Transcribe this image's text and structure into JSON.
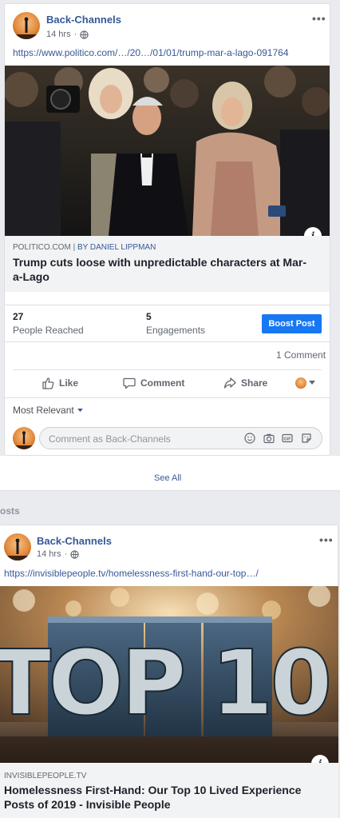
{
  "post1": {
    "page_name": "Back-Channels",
    "time": "14 hrs",
    "privacy_icon": "globe-icon",
    "url": "https://www.politico.com/…/20…/01/01/trump-mar-a-lago-091764",
    "source": "POLITICO.COM",
    "separator": " | ",
    "byline": "BY DANIEL LIPPMAN",
    "headline": "Trump cuts loose with unpredictable characters at Mar-a-Lago",
    "people_reached": "27",
    "people_reached_label": "People Reached",
    "engagements": "5",
    "engagements_label": "Engagements",
    "boost_label": "Boost Post",
    "comments_count": "1 Comment",
    "like_label": "Like",
    "comment_label": "Comment",
    "share_label": "Share",
    "most_relevant": "Most Relevant",
    "comment_placeholder": "Comment as Back-Channels"
  },
  "see_all": "See All",
  "section_title": "osts",
  "post2": {
    "page_name": "Back-Channels",
    "time": "14 hrs",
    "privacy_icon": "globe-icon",
    "url": "https://invisiblepeople.tv/homelessness-first-hand-our-top…/",
    "image_text": "TOP 10",
    "source": "INVISIBLEPEOPLE.TV",
    "headline": "Homelessness First-Hand: Our Top 10 Lived Experience Posts of 2019 - Invisible People"
  },
  "colors": {
    "link": "#385898",
    "boost": "#1877f2",
    "background": "#e9ebee"
  }
}
